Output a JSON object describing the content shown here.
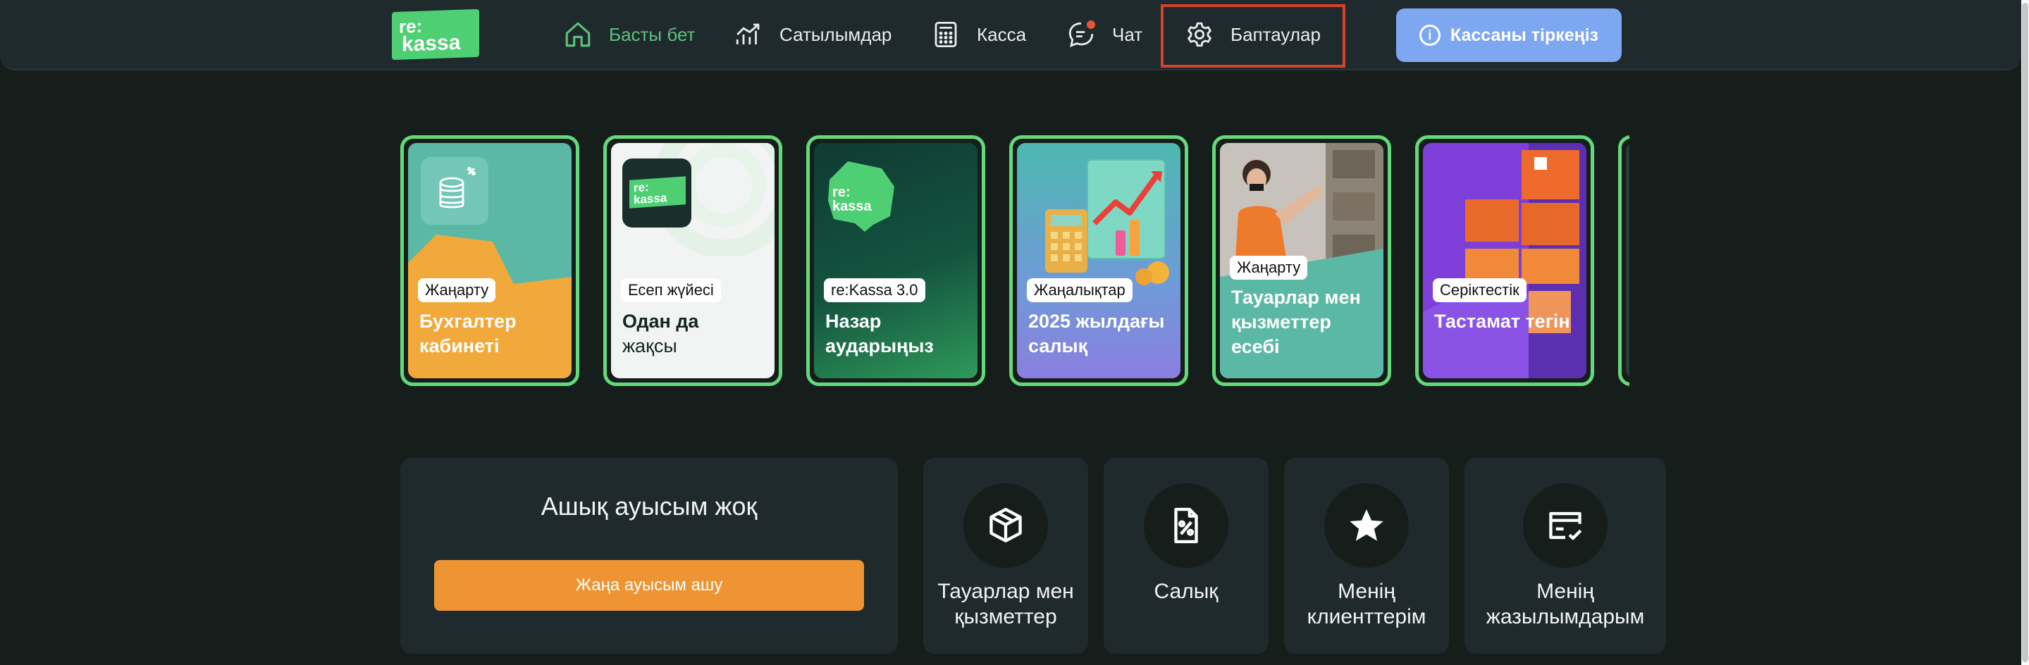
{
  "header": {
    "logo": {
      "line1": "re:",
      "line2": "kassa"
    },
    "nav": [
      {
        "label": "Басты бет",
        "icon": "home-icon",
        "active": true
      },
      {
        "label": "Сатылымдар",
        "icon": "chart-icon"
      },
      {
        "label": "Касса",
        "icon": "calculator-icon"
      },
      {
        "label": "Чат",
        "icon": "chat-icon"
      },
      {
        "label": "Баптаулар",
        "icon": "gear-icon",
        "highlighted": true
      }
    ],
    "register_button": {
      "label": "Кассаны тіркеңіз",
      "icon": "info-icon"
    }
  },
  "stories": [
    {
      "tag": "Жаңарту",
      "title": "Бухгалтер кабинеті"
    },
    {
      "tag": "Есеп жүйесі",
      "title_bold": "Одан да",
      "title_rest": "жақсы",
      "logo_line1": "re:",
      "logo_line2": "kassa"
    },
    {
      "tag": "re:Kassa 3.0",
      "title": "Назар аударыңыз",
      "logo_line1": "re:",
      "logo_line2": "kassa"
    },
    {
      "tag": "Жаңалықтар",
      "title": "2025 жылдағы салық"
    },
    {
      "tag": "Жаңарту",
      "title": "Тауарлар мен қызметтер есебі"
    },
    {
      "tag": "Серіктестік",
      "title": "Тастамат тегін"
    }
  ],
  "shift": {
    "title": "Ашық ауысым жоқ",
    "button": "Жаңа ауысым ашу"
  },
  "tiles": [
    {
      "label": "Тауарлар мен қызметтер",
      "icon": "box-icon"
    },
    {
      "label": "Салық",
      "icon": "tax-icon"
    },
    {
      "label": "Менің клиенттерім",
      "icon": "star-icon"
    },
    {
      "label": "Менің жазылымдарым",
      "icon": "card-icon"
    }
  ],
  "colors": {
    "accent_green": "#63d97a",
    "orange": "#ee9432",
    "blue_button": "#7ea7f2",
    "highlight_red": "#d9412b"
  }
}
